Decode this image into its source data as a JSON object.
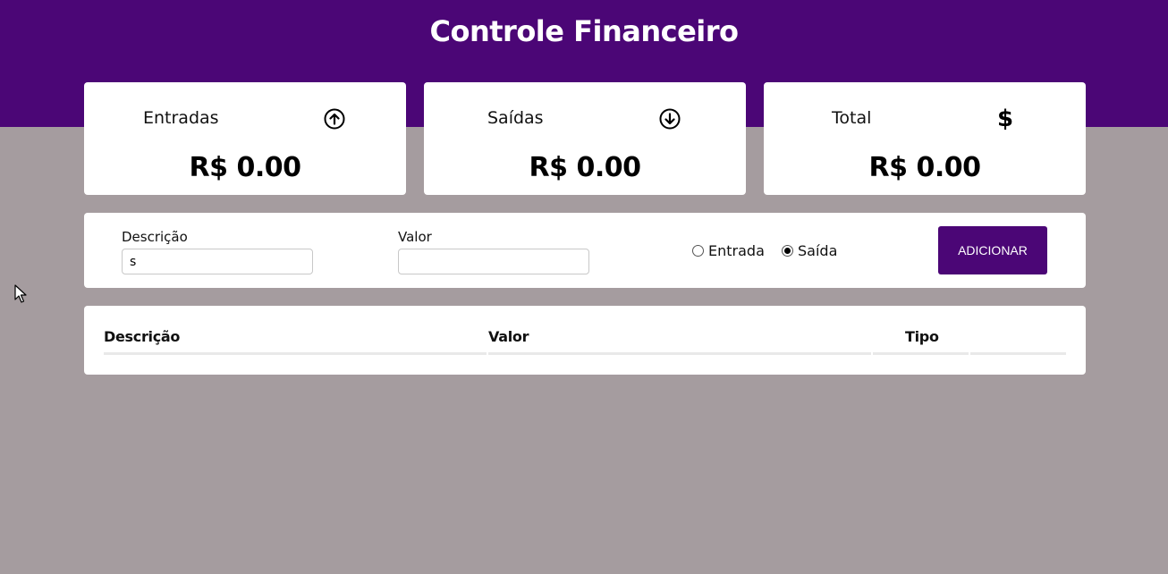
{
  "header": {
    "title": "Controle Financeiro"
  },
  "cards": [
    {
      "label": "Entradas",
      "value": "R$ 0.00",
      "icon": "arrow-up-circle-icon"
    },
    {
      "label": "Saídas",
      "value": "R$ 0.00",
      "icon": "arrow-down-circle-icon"
    },
    {
      "label": "Total",
      "value": "R$ 0.00",
      "icon": "dollar-icon",
      "icon_glyph": "$"
    }
  ],
  "form": {
    "description_label": "Descrição",
    "description_value": "s",
    "value_label": "Valor",
    "value_value": "",
    "radio_entrada": "Entrada",
    "radio_saida": "Saída",
    "selected_type": "Saída",
    "add_button": "ADICIONAR"
  },
  "table": {
    "headers": [
      "Descrição",
      "Valor",
      "Tipo"
    ]
  },
  "colors": {
    "header": "#4b0676",
    "background": "#a59c9f",
    "button": "#4b0676"
  }
}
